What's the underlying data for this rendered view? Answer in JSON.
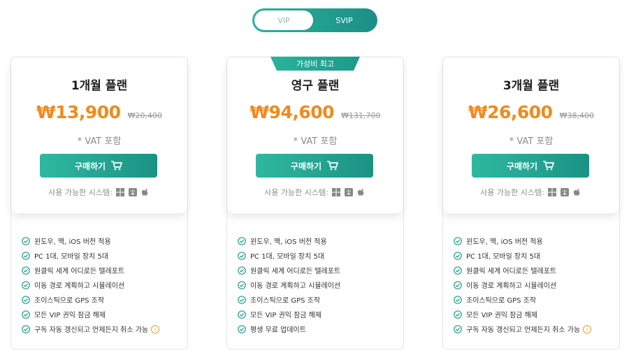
{
  "toggle": {
    "vip_label": "VIP",
    "svip_label": "SVIP"
  },
  "plans": [
    {
      "badge": "",
      "name": "1개월 플랜",
      "price": "₩13,900",
      "old_price": "₩20,400",
      "vat": "* VAT 포함",
      "buy_label": "구매하기",
      "systems_label": "사용 가능한 시스템:",
      "features": [
        "윈도우, 맥, iOS 버전 적용",
        "PC 1대, 모바일 장치 5대",
        "원클릭 세계 어디로든 텔레포트",
        "이동 경로 계획하고 시뮬레이션",
        "조이스틱으로 GPS 조작",
        "모든 VIP 권익 잠금 해제",
        "구독 자동 갱신되고 언제든지 취소 가능"
      ]
    },
    {
      "badge": "가성비 최고",
      "name": "영구 플랜",
      "price": "₩94,600",
      "old_price": "₩131,700",
      "vat": "* VAT 포함",
      "buy_label": "구매하기",
      "systems_label": "사용 가능한 시스템:",
      "features": [
        "윈도우, 맥, iOS 버전 적용",
        "PC 1대, 모바일 장치 5대",
        "원클릭 세계 어디로든 텔레포트",
        "이동 경로 계획하고 시뮬레이션",
        "조이스틱으로 GPS 조작",
        "모든 VIP 권익 잠금 해제",
        "평생 무료 업데이트"
      ]
    },
    {
      "badge": "",
      "name": "3개월 플랜",
      "price": "₩26,600",
      "old_price": "₩38,400",
      "vat": "* VAT 포함",
      "buy_label": "구매하기",
      "systems_label": "사용 가능한 시스템:",
      "features": [
        "윈도우, 맥, iOS 버전 적용",
        "PC 1대, 모바일 장치 5대",
        "원클릭 세계 어디로든 텔레포트",
        "이동 경로 계획하고 시뮬레이션",
        "조이스틱으로 GPS 조작",
        "모든 VIP 권익 잠금 해제",
        "구독 자동 갱신되고 언제든지 취소 가능"
      ]
    }
  ],
  "colors": {
    "accent": "#1f9e8c",
    "price": "#f08a1c",
    "info": "#f0a020"
  },
  "icons": {
    "cart": "cart-icon",
    "windows": "windows-icon",
    "mac": "mac-finder-icon",
    "apple": "apple-icon",
    "check": "check-circle-icon",
    "info": "info-icon"
  }
}
